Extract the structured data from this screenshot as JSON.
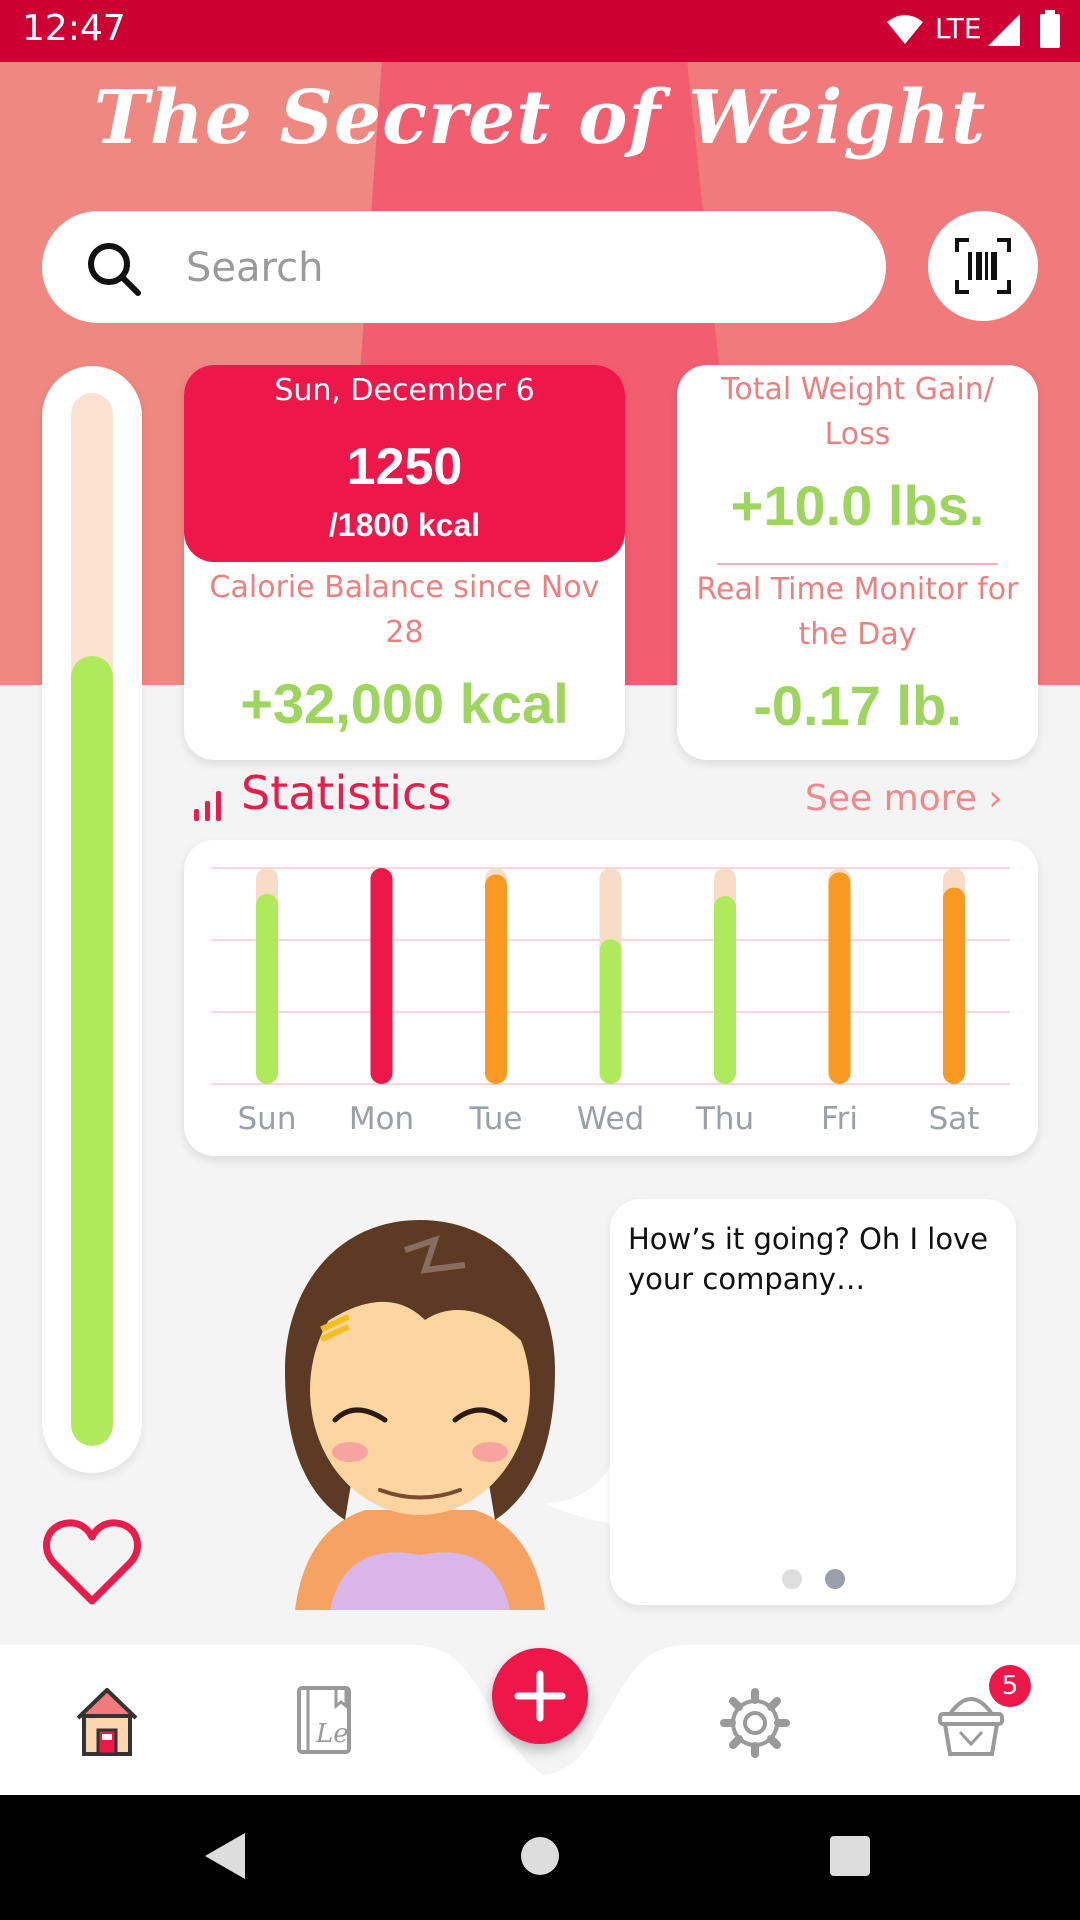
{
  "status_bar": {
    "time": "12:47",
    "network": "LTE"
  },
  "app": {
    "title": "The Secret of Weight"
  },
  "search": {
    "placeholder": "Search"
  },
  "daily_progress": {
    "fill_fraction": 0.75,
    "fill_color": "#aeea5c",
    "track_color": "#fbe3d2"
  },
  "calorie_card": {
    "date": "Sun, December 6",
    "consumed": "1250",
    "goal": "/1800 kcal",
    "balance_label": "Calorie Balance since Nov 28",
    "balance_value": "+32,000 kcal"
  },
  "weight_card": {
    "total_label": "Total Weight Gain/ Loss",
    "total_value": "+10.0 lbs.",
    "monitor_label": "Real Time Monitor for the Day",
    "monitor_value": "-0.17 lb."
  },
  "statistics": {
    "title": "Statistics",
    "see_more": "See more ›"
  },
  "chart_data": {
    "type": "bar",
    "categories": [
      "Sun",
      "Mon",
      "Tue",
      "Wed",
      "Thu",
      "Fri",
      "Sat"
    ],
    "values": [
      0.88,
      1.0,
      0.97,
      0.67,
      0.87,
      0.98,
      0.91
    ],
    "colors": [
      "#aeea5c",
      "#ee1749",
      "#f89a22",
      "#aeea5c",
      "#aeea5c",
      "#f89a22",
      "#f89a22"
    ],
    "ylim": [
      0,
      1
    ],
    "grid": true
  },
  "assistant": {
    "message": "How’s it going? Oh I love your company…",
    "page_dots": 2,
    "active_dot": 1
  },
  "bottom_nav": {
    "items": [
      {
        "icon": "home-icon"
      },
      {
        "icon": "diary-icon"
      },
      {
        "icon": "add-icon"
      },
      {
        "icon": "settings-icon"
      },
      {
        "icon": "basket-icon"
      }
    ],
    "basket_badge": "5"
  },
  "colors": {
    "accent": "#ee1749",
    "positive": "#9ed55e",
    "header": "#ef7f80"
  }
}
